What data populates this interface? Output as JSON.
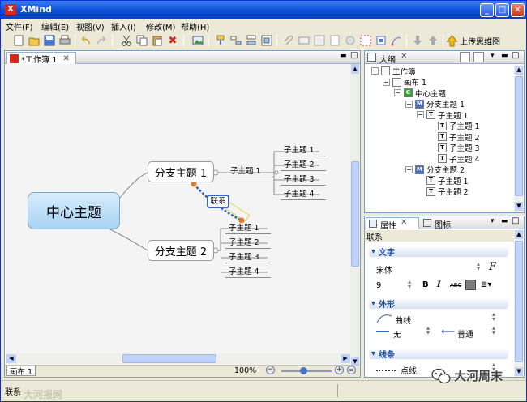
{
  "window": {
    "title": "XMind",
    "app_icon": "X"
  },
  "menu": [
    "文件(F)",
    "编辑(E)",
    "视图(V)",
    "插入(I)",
    "修改(M)",
    "帮助(H)"
  ],
  "toolbar": {
    "upload_label": "上传思维图"
  },
  "editor": {
    "tab_label": "*工作簿 1",
    "zoom": "100%",
    "sheet_tab": "画布 1"
  },
  "mindmap": {
    "central": "中心主题",
    "branch1": "分支主题 1",
    "branch2": "分支主题 2",
    "branch1_child": "子主题 1",
    "branch1_subs": [
      "子主题 1",
      "子主题 2",
      "子主题 3",
      "子主题 4"
    ],
    "branch2_subs": [
      "子主题 1",
      "子主题 2",
      "子主题 3",
      "子主题 4"
    ],
    "relationship": "联系"
  },
  "outline": {
    "title": "大纲",
    "items": [
      {
        "label": "工作簿",
        "icon": "",
        "depth": 0
      },
      {
        "label": "画布 1",
        "icon": "",
        "depth": 1
      },
      {
        "label": "中心主题",
        "icon": "C",
        "depth": 2
      },
      {
        "label": "分支主题 1",
        "icon": "M",
        "depth": 3
      },
      {
        "label": "子主题 1",
        "icon": "T",
        "depth": 4
      },
      {
        "label": "子主题 1",
        "icon": "T",
        "depth": 5
      },
      {
        "label": "子主题 2",
        "icon": "T",
        "depth": 5
      },
      {
        "label": "子主题 3",
        "icon": "T",
        "depth": 5
      },
      {
        "label": "子主题 4",
        "icon": "T",
        "depth": 5
      },
      {
        "label": "分支主题 2",
        "icon": "M",
        "depth": 3
      },
      {
        "label": "子主题 1",
        "icon": "T",
        "depth": 4
      },
      {
        "label": "子主题 2",
        "icon": "T",
        "depth": 4
      }
    ]
  },
  "properties": {
    "tab_props": "属性",
    "tab_icons": "图标",
    "object_label": "联系",
    "section_text": "文字",
    "font_name": "宋体",
    "font_size": "9",
    "bold": "B",
    "italic": "I",
    "strike": "ABC",
    "section_shape": "外形",
    "shape_value": "曲线",
    "start_arrow": "无",
    "end_arrow": "普通",
    "section_line": "线条",
    "line_style": "点线"
  },
  "status": {
    "text": "联系"
  },
  "watermark": {
    "text": "大河周末",
    "bottom_left": "大河报网"
  },
  "colors": {
    "title_bar": "#0a4ed6",
    "central_node": "#b6dcf6",
    "relationship": "#3a62b8"
  }
}
